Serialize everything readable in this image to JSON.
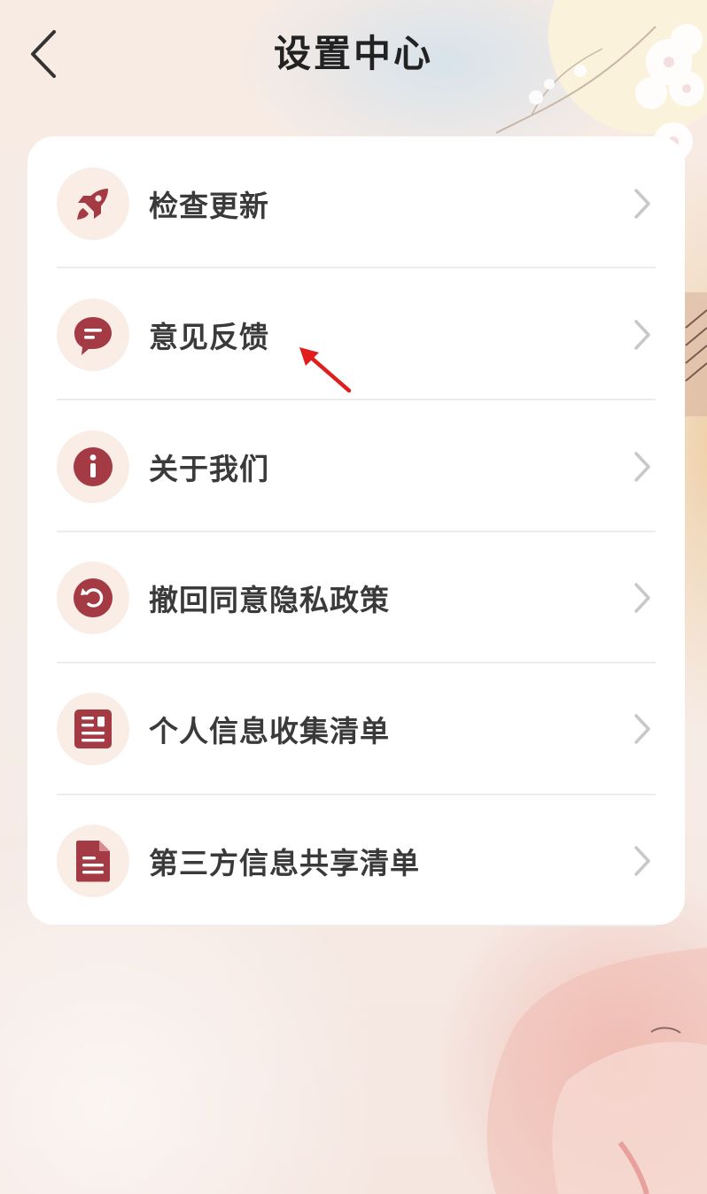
{
  "header": {
    "title": "设置中心",
    "back_icon": "chevron-left-icon"
  },
  "settings": {
    "items": [
      {
        "label": "检查更新",
        "icon": "rocket-icon"
      },
      {
        "label": "意见反馈",
        "icon": "chat-bubble-icon"
      },
      {
        "label": "关于我们",
        "icon": "info-icon"
      },
      {
        "label": "撤回同意隐私政策",
        "icon": "undo-icon"
      },
      {
        "label": "个人信息收集清单",
        "icon": "list-document-icon"
      },
      {
        "label": "第三方信息共享清单",
        "icon": "file-icon"
      }
    ]
  },
  "annotation": {
    "icon": "red-arrow-icon",
    "color": "#e01e1e"
  },
  "colors": {
    "accent": "#a33a44",
    "icon_bg": "#f9ede6",
    "card_bg": "#ffffff",
    "chevron": "#c8c8c8"
  }
}
